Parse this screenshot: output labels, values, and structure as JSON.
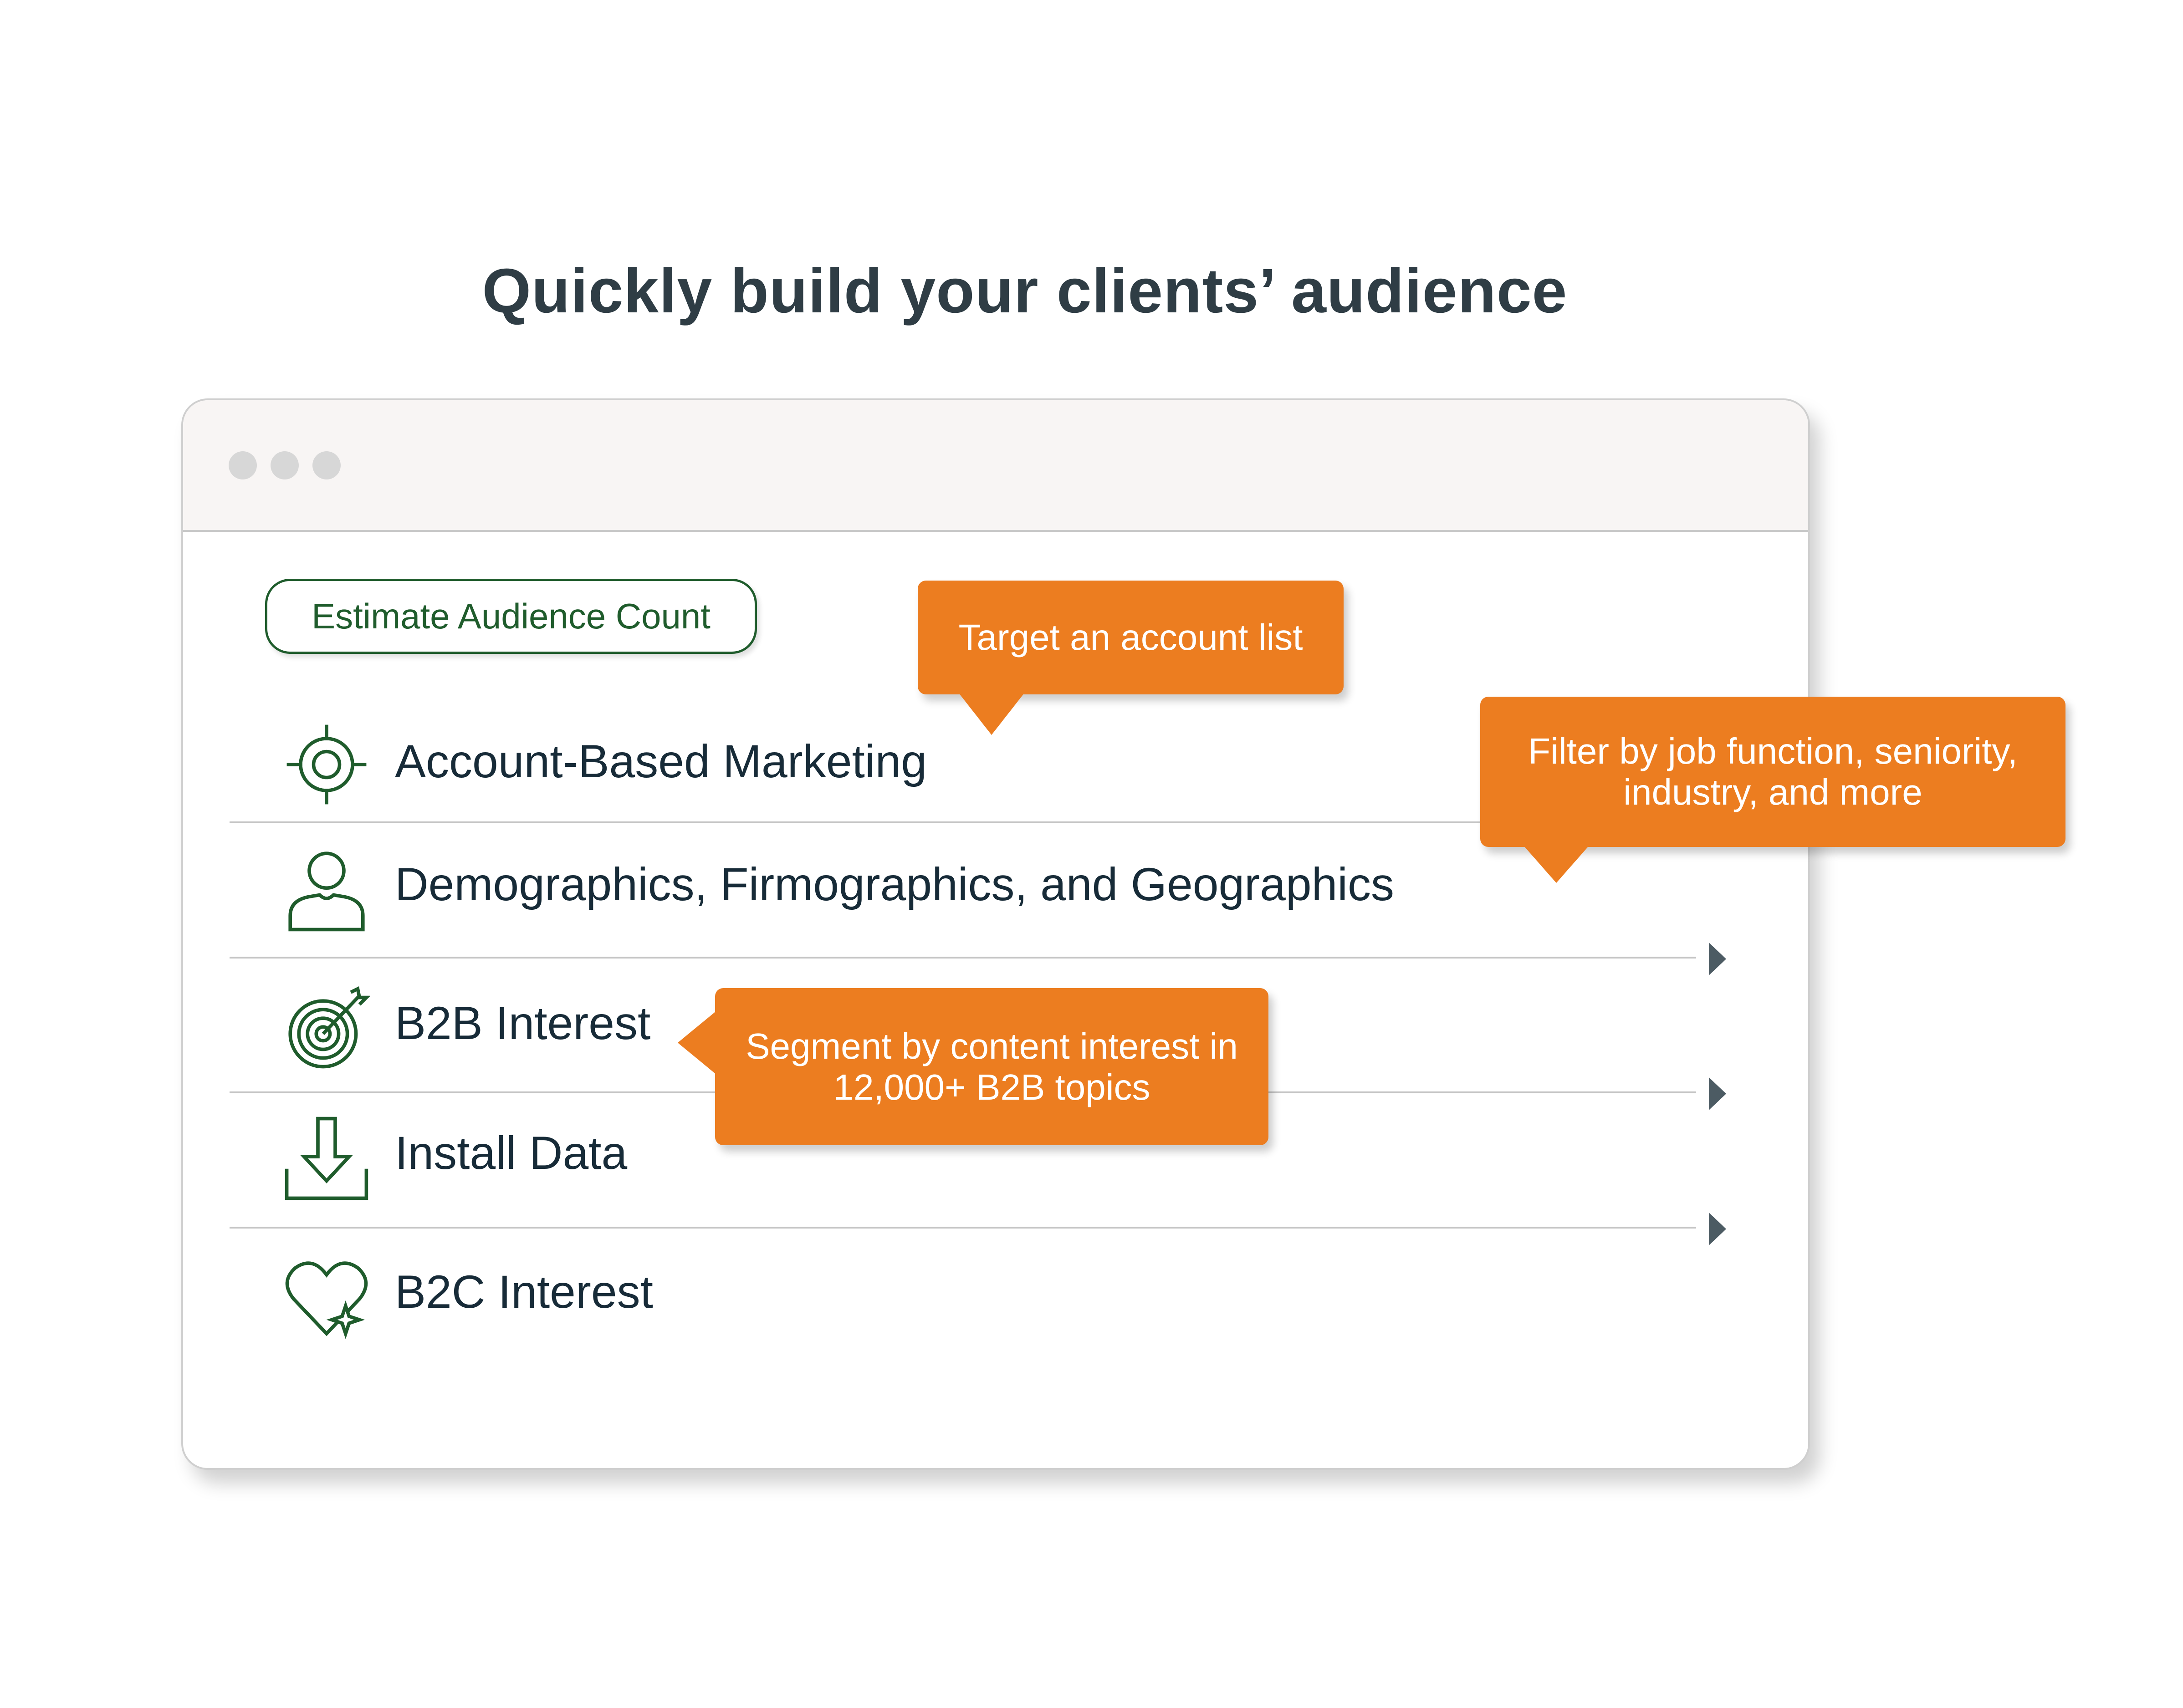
{
  "page": {
    "title": "Quickly build your clients’ audience"
  },
  "window": {
    "controls": [
      "window-dot-1",
      "window-dot-2",
      "window-dot-3"
    ]
  },
  "toolbar": {
    "estimate_label": "Estimate Audience Count"
  },
  "rows": [
    {
      "label": "Account-Based Marketing",
      "icon": "crosshair-target-icon"
    },
    {
      "label": "Demographics, Firmographics, and Geographics",
      "icon": "person-icon"
    },
    {
      "label": "B2B Interest",
      "icon": "bullseye-arrow-icon"
    },
    {
      "label": "Install Data",
      "icon": "download-tray-icon"
    },
    {
      "label": "B2C Interest",
      "icon": "heart-sparkle-icon"
    }
  ],
  "callouts": {
    "abm": "Target an account list",
    "filter": "Filter by job function, seniority, industry, and more",
    "segment": "Segment by content interest in 12,000+ B2B topics"
  },
  "colors": {
    "accent_green": "#1f5c2c",
    "callout_orange": "#ec7d20",
    "text_dark": "#172b38",
    "chevron": "#4c5b63"
  }
}
